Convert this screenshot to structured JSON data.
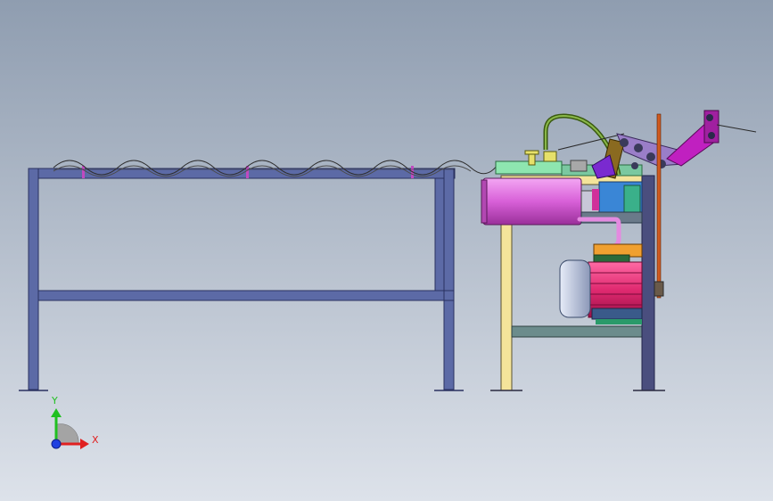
{
  "viewport": {
    "background_top": "#8f9db0",
    "background_bottom": "#dde2ea"
  },
  "axis_triad": {
    "x_label": "X",
    "y_label": "Y",
    "x_color": "#e02020",
    "y_color": "#20c020",
    "z_color": "#2040e0"
  },
  "components": [
    {
      "name": "infeed-conveyor-frame",
      "color": "#5c6aa6"
    },
    {
      "name": "wavy-wire-feed",
      "color": "#3a3a3a"
    },
    {
      "name": "machine-frame-left-leg",
      "color": "#f4e49a"
    },
    {
      "name": "machine-frame-right-leg",
      "color": "#4a4e7e"
    },
    {
      "name": "cylinder-body",
      "color": "#e070e0"
    },
    {
      "name": "electric-motor",
      "color": "#e8387c"
    },
    {
      "name": "motor-end-cap",
      "color": "#b8c4e0"
    },
    {
      "name": "hydraulic-hose",
      "color": "#5a7a1c"
    },
    {
      "name": "bending-arm",
      "color": "#c020c0"
    },
    {
      "name": "guide-rod",
      "color": "#d05a20"
    }
  ]
}
